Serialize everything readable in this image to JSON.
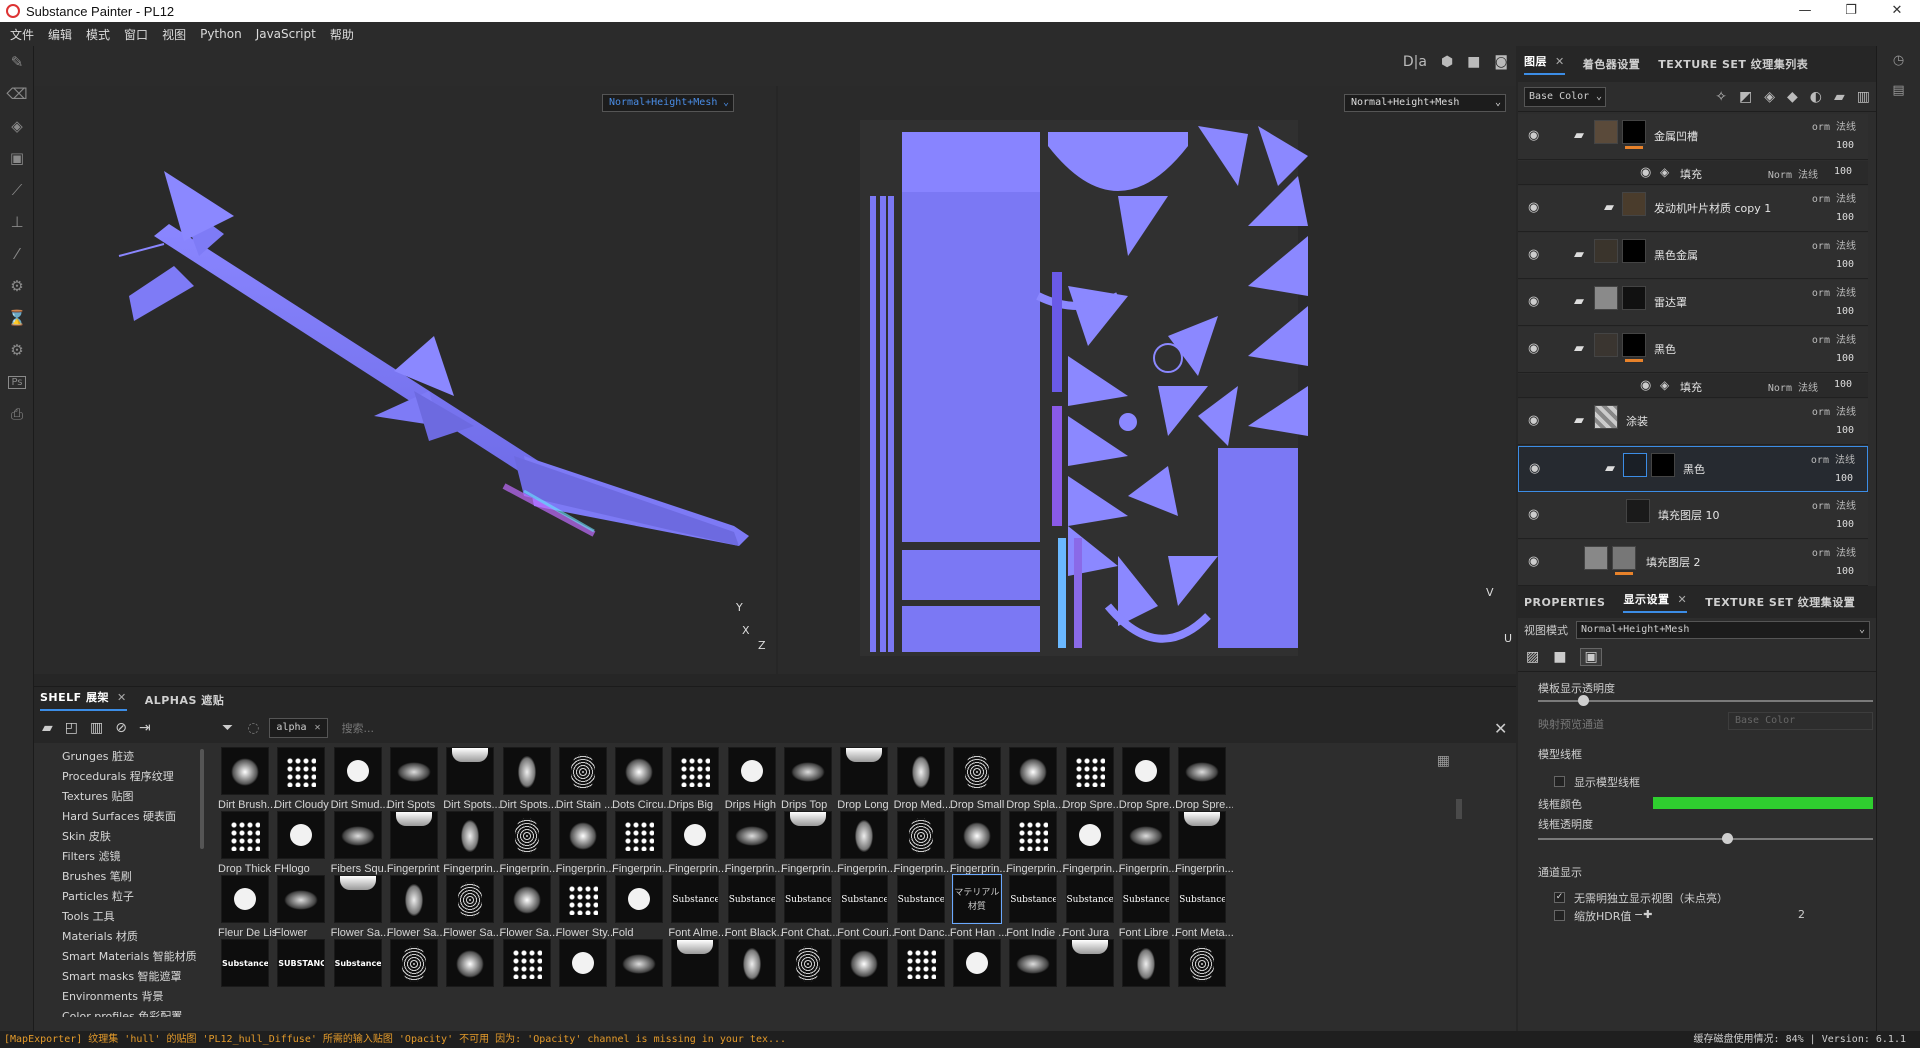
{
  "window": {
    "title": "Substance Painter - PL12",
    "minimize": "—",
    "maximize": "❐",
    "close": "✕"
  },
  "menu": [
    "文件",
    "编辑",
    "模式",
    "窗口",
    "视图",
    "Python",
    "JavaScript",
    "帮助"
  ],
  "viewport": {
    "mode_left": "Normal+Height+Mesh",
    "mode_right": "Normal+Height+Mesh",
    "axis3d": {
      "y": "Y",
      "x": "X",
      "z": "Z"
    },
    "axis2d": {
      "v": "V",
      "u": "U"
    },
    "toolbar_label": "D|a"
  },
  "layers_panel": {
    "tabs": [
      {
        "label": "图层",
        "active": true
      },
      {
        "label": "着色器设置"
      },
      {
        "label": "TEXTURE SET 纹理集列表"
      }
    ],
    "channel": "Base Color",
    "layers": [
      {
        "name": "金属凹槽",
        "blend": "orm 法线",
        "opacity": "100",
        "thumb_color": "#5a4a3a",
        "mask": "#000000"
      },
      {
        "name": "填充",
        "sub": true,
        "blend": "Norm 法线",
        "opacity": "100"
      },
      {
        "name": "发动机叶片材质 copy 1",
        "blend": "orm 法线",
        "opacity": "100",
        "thumb_color": "#4a3c2c"
      },
      {
        "name": "黑色金属",
        "blend": "orm 法线",
        "opacity": "100",
        "thumb_color": "#3a342c",
        "mask": "#000000"
      },
      {
        "name": "雷达罩",
        "blend": "orm 法线",
        "opacity": "100",
        "thumb_color": "#8a8a8a",
        "mask": "#111111"
      },
      {
        "name": "黑色",
        "blend": "orm 法线",
        "opacity": "100",
        "thumb_color": "#3a3530",
        "mask": "#000000"
      },
      {
        "name": "填充",
        "sub": true,
        "blend": "Norm 法线",
        "opacity": "100"
      },
      {
        "name": "涂装",
        "blend": "orm 法线",
        "opacity": "100",
        "thumb_color": "#bbbbbb"
      },
      {
        "name": "黑色",
        "blend": "orm 法线",
        "opacity": "100",
        "thumb_color": "#1a1f26",
        "mask": "#000000"
      },
      {
        "name": "填充图层 10",
        "blend": "orm 法线",
        "opacity": "100",
        "thumb_color": "#1a1a1a"
      },
      {
        "name": "填充图层 2",
        "blend": "orm 法线",
        "opacity": "100",
        "thumb_color": "#888888",
        "mask": "#777777"
      }
    ]
  },
  "properties_panel": {
    "tabs": [
      {
        "label": "PROPERTIES"
      },
      {
        "label": "显示设置",
        "active": true
      },
      {
        "label": "TEXTURE SET 纹理集设置"
      }
    ],
    "view_mode_label": "视图模式",
    "view_mode_value": "Normal+Height+Mesh",
    "opacity_label": "模板显示透明度",
    "opacity_value": 0.12,
    "map_preview_label": "映射预览通道",
    "map_preview_value": "Base Color",
    "wireframe_section": "模型线框",
    "show_wireframe": "显示模型线框",
    "wire_color_label": "线框颜色",
    "wire_color": "#2fcf2f",
    "wire_opacity_label": "线框透明度",
    "wire_opacity_value": 0.55,
    "channel_section": "通道显示",
    "isolated_label": "无需明独立显示视图（未点亮）",
    "hdr_label": "缩放HDR值",
    "hdr_value": "2"
  },
  "shelf": {
    "tabs": [
      {
        "label": "SHELF 展架",
        "active": true
      },
      {
        "label": "ALPHAS 遮贴"
      }
    ],
    "filter": "alpha",
    "search_placeholder": "搜索...",
    "categories": [
      "Grunges 脏迹",
      "Procedurals 程序纹理",
      "Textures 贴图",
      "Hard Surfaces 硬表面",
      "Skin 皮肤",
      "Filters 滤镜",
      "Brushes 笔刷",
      "Particles 粒子",
      "Tools 工具",
      "Materials 材质",
      "Smart Materials 智能材质",
      "Smart masks 智能遮罩",
      "Environments 背景",
      "Color profiles 色彩配置"
    ],
    "items": [
      [
        "Dirt Brush...",
        "Dirt Cloudy",
        "Dirt Smud...",
        "Dirt Spots",
        "Dirt Spots...",
        "Dirt Spots...",
        "Dirt Stain ...",
        "Dots Circu...",
        "Drips Big",
        "Drips High",
        "Drips Top",
        "Drop Long",
        "Drop Med...",
        "Drop Small",
        "Drop Spla...",
        "Drop Spre...",
        "Drop Spre...",
        "Drop Spre..."
      ],
      [
        "Drop Thick",
        "FHlogo",
        "Fibers Squ...",
        "Fingerprint",
        "Fingerprin...",
        "Fingerprin...",
        "Fingerprin...",
        "Fingerprin...",
        "Fingerprin...",
        "Fingerprin...",
        "Fingerprin...",
        "Fingerprin...",
        "Fingerprin...",
        "Fingerprin...",
        "Fingerprin...",
        "Fingerprin...",
        "Fingerprin...",
        "Fingerprin..."
      ],
      [
        "Fleur De Lis",
        "Flower",
        "Flower Sa...",
        "Flower Sa...",
        "Flower Sa...",
        "Flower Sa...",
        "Flower Sty...",
        "Fold",
        "Font Alme...",
        "Font Black...",
        "Font Chat...",
        "Font Couri...",
        "Font Danc...",
        "Font Han ...",
        "Font Indie ...",
        "Font Jura",
        "Font Libre ...",
        "Font Meta..."
      ],
      [
        "",
        "",
        "",
        "",
        "",
        "",
        "",
        "",
        "",
        "",
        "",
        "",
        "",
        "",
        "",
        "",
        "",
        ""
      ]
    ],
    "font_texts": [
      "Substance",
      "Substance",
      "Substance",
      "Substance",
      "Substance",
      "マテリアル材質",
      "Substance",
      "Substance",
      "Substance",
      "Substance"
    ],
    "row4_texts": [
      "Substance",
      "SUBSTANCE",
      "Substance"
    ]
  },
  "status": {
    "message": "[MapExporter] 纹理集 'hull' 的贴图 'PL12_hull_Diffuse' 所需的输入贴图 'Opacity' 不可用 因为: 'Opacity' channel is missing in your tex...",
    "cache": "缓存磁盘使用情况:",
    "cache_value": "84%",
    "version": "Version: 6.1.1"
  }
}
